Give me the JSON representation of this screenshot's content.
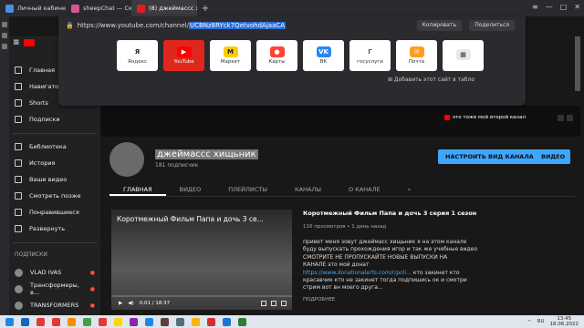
{
  "browser": {
    "tabs": [
      {
        "label": "Личный кабинет",
        "active": false
      },
      {
        "label": "sheepChat — Скачивание",
        "active": false
      },
      {
        "label": "(8) джеймассс хищьни",
        "active": true
      }
    ],
    "new_tab": "+",
    "address": {
      "url_prefix": "https://www.youtube.com/channel/",
      "url_selected": "UCBNz8RYck7QetvohdAjaaCA",
      "copy_label": "Копировать",
      "share_label": "Поделиться"
    },
    "tiles": [
      {
        "label": "Яндекс",
        "ico": "Я",
        "color": "#ffffff",
        "fg": "#222"
      },
      {
        "label": "YouTube",
        "ico": "▶",
        "color": "#ff0000",
        "fg": "#fff"
      },
      {
        "label": "Маркет",
        "ico": "M",
        "color": "#ffcc00",
        "fg": "#222"
      },
      {
        "label": "Карты",
        "ico": "●",
        "color": "#ff4433",
        "fg": "#fff"
      },
      {
        "label": "ВК",
        "ico": "VK",
        "color": "#2787f5",
        "fg": "#fff"
      },
      {
        "label": "госуслуги",
        "ico": "Г",
        "color": "#ffffff",
        "fg": "#2b5ba8"
      },
      {
        "label": "Почта",
        "ico": "✉",
        "color": "#ff9e1b",
        "fg": "#fff"
      },
      {
        "label": "",
        "ico": "▦",
        "color": "#e8e8e8",
        "fg": "#333"
      }
    ],
    "add_tile_label": "Добавить этот сайт в табло"
  },
  "sidebar": {
    "items": [
      {
        "label": "Главная"
      },
      {
        "label": "Навигатор"
      },
      {
        "label": "Shorts"
      },
      {
        "label": "Подписки"
      }
    ],
    "items2": [
      {
        "label": "Библиотека"
      },
      {
        "label": "История"
      },
      {
        "label": "Ваши видео"
      },
      {
        "label": "Смотреть позже"
      },
      {
        "label": "Понравившиеся"
      },
      {
        "label": "Развернуть"
      }
    ],
    "subs_header": "ПОДПИСКИ",
    "subs": [
      {
        "label": "VLAD IVAS",
        "badge": "●"
      },
      {
        "label": "Трансформеры, в...",
        "badge": "●"
      },
      {
        "label": "TRANSFORMERS",
        "badge": "●"
      }
    ]
  },
  "channel": {
    "banner_text": "это тоже мой второй канал",
    "name": "джеймассс хищьник",
    "subscribers": "181 подписчик",
    "customize_label": "НАСТРОИТЬ ВИД КАНАЛА",
    "video_label": "ВИДЕО",
    "tabs": [
      "ГЛАВНАЯ",
      "ВИДЕО",
      "ПЛЕЙЛИСТЫ",
      "КАНАЛЫ",
      "О КАНАЛЕ"
    ]
  },
  "video": {
    "player_title": "Коротмежный Фильм Папа и дочь 3 се...",
    "time": "0:01 / 18:37",
    "title": "Коротмежный Фильм Папа и дочь 3 серия 1 сезон",
    "meta": "116 просмотров • 1 день назад",
    "desc_lines": [
      "привет меня зовут джеймасс хищьник я на этом канале",
      "буду выпускать прохождения игор и так же учебные видео",
      "СМОТРИТЕ НЕ ПРОПУСКАЙТЕ НОВЫЕ ВЫПУСКИ НА",
      "КАНАЛЕ  это мой донат"
    ],
    "desc_link": "https://www.donationalerts.com/r/poli...",
    "desc_after_link": " кто закинет  кто",
    "desc_lines2": [
      "красавчик кто не закинет тогда подпишись ок и смотри",
      "стрим вот вн моего друга..."
    ],
    "more_label": "ПОДРОБНЕЕ"
  },
  "taskbar": {
    "lang": "RU",
    "time": "13:45",
    "date": "18.06.2022",
    "icons": [
      "#1565c0",
      "#e53935",
      "#e53935",
      "#fb8c00",
      "#43a047",
      "#e53935",
      "#ffd600",
      "#8e24aa",
      "#1e88e5",
      "#5d4037",
      "#546e7a",
      "#ffb300",
      "#d32f2f",
      "#1976d2",
      "#2e7d32"
    ]
  }
}
